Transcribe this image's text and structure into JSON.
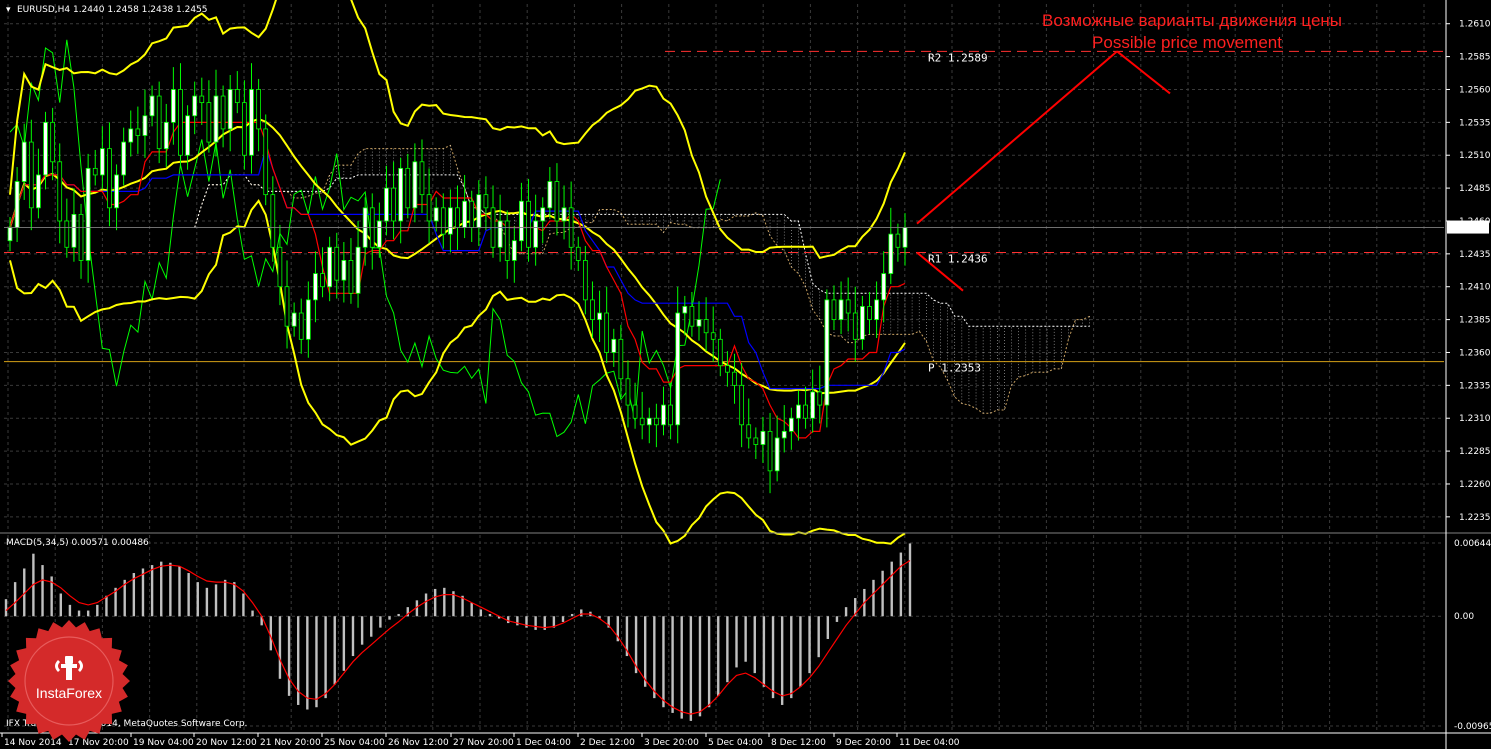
{
  "header": {
    "symbol_title": "EURUSD,H4  1.2440 1.2458 1.2438 1.2455",
    "macd_title": "MACD(5,34,5) 0.00571 0.00486"
  },
  "annotation": {
    "line1": "Возможные варианты движения цены",
    "line2": "Possible price movement"
  },
  "levels": [
    {
      "name": "R2",
      "label": "R2  1.2589",
      "value": 1.2589,
      "color": "#ff3030",
      "style": "dashed"
    },
    {
      "name": "R1",
      "label": "R1  1.2436",
      "value": 1.2436,
      "color": "#ff3030",
      "style": "dashed"
    },
    {
      "name": "P",
      "label": "P  1.2353",
      "value": 1.2353,
      "color": "#d4a017",
      "style": "solid"
    }
  ],
  "current_price": {
    "label": "1.2455",
    "value": 1.2455
  },
  "footer": {
    "copyright": "IFX Trader, © 2001-2014, MetaQuotes Software Corp."
  },
  "logo": {
    "text": "InstaForex",
    "color": "#d42a2a"
  },
  "colors": {
    "background": "#000000",
    "grid": "#3a3a3a",
    "bullish_candle": "#ffffff",
    "bearish_candle": "#000000",
    "candle_wick": "#00ff00",
    "bollinger": "#ffff00",
    "tenkan": "#ff0000",
    "kijun": "#0000ff",
    "chikou": "#00ff00",
    "cloud": "#ffffff",
    "macd_hist": "#c0c0c0",
    "macd_signal": "#ff0000",
    "forecast": "#ff0000",
    "annotation_text": "#ff2020"
  },
  "chart_data": [
    {
      "type": "candlestick",
      "title": "EURUSD,H4",
      "ylim": [
        1.2225,
        1.2625
      ],
      "y_ticks": [
        "1.2610",
        "1.2585",
        "1.2560",
        "1.2535",
        "1.2510",
        "1.2485",
        "1.2460",
        "1.2435",
        "1.2410",
        "1.2385",
        "1.2360",
        "1.2335",
        "1.2310",
        "1.2285",
        "1.2260",
        "1.2235"
      ],
      "x_labels": [
        "14 Nov 2014",
        "17 Nov 20:00",
        "19 Nov 04:00",
        "20 Nov 12:00",
        "21 Nov 20:00",
        "25 Nov 04:00",
        "26 Nov 12:00",
        "27 Nov 20:00",
        "1 Dec 04:00",
        "2 Dec 12:00",
        "3 Dec 20:00",
        "5 Dec 04:00",
        "8 Dec 12:00",
        "9 Dec 20:00",
        "11 Dec 04:00"
      ],
      "closes": [
        1.2455,
        1.249,
        1.252,
        1.247,
        1.2495,
        1.2535,
        1.2505,
        1.246,
        1.244,
        1.2465,
        1.243,
        1.25,
        1.2495,
        1.2515,
        1.247,
        1.2495,
        1.252,
        1.253,
        1.2525,
        1.254,
        1.2555,
        1.2515,
        1.2535,
        1.256,
        1.251,
        1.254,
        1.2555,
        1.255,
        1.252,
        1.2555,
        1.253,
        1.256,
        1.255,
        1.251,
        1.256,
        1.253,
        1.248,
        1.244,
        1.241,
        1.238,
        1.239,
        1.237,
        1.24,
        1.242,
        1.241,
        1.244,
        1.2415,
        1.243,
        1.2405,
        1.244,
        1.247,
        1.244,
        1.246,
        1.2485,
        1.246,
        1.25,
        1.247,
        1.2505,
        1.248,
        1.246,
        1.247,
        1.245,
        1.247,
        1.2455,
        1.2475,
        1.2455,
        1.248,
        1.247,
        1.244,
        1.246,
        1.243,
        1.2445,
        1.2475,
        1.244,
        1.246,
        1.247,
        1.249,
        1.246,
        1.247,
        1.244,
        1.243,
        1.24,
        1.2385,
        1.239,
        1.236,
        1.237,
        1.234,
        1.232,
        1.231,
        1.2305,
        1.231,
        1.2305,
        1.232,
        1.2305,
        1.239,
        1.2395,
        1.238,
        1.2385,
        1.2375,
        1.237,
        1.235,
        1.2345,
        1.2335,
        1.2305,
        1.2295,
        1.229,
        1.23,
        1.227,
        1.2295,
        1.23,
        1.231,
        1.232,
        1.231,
        1.233,
        1.232,
        1.24,
        1.2385,
        1.24,
        1.239,
        1.237,
        1.2395,
        1.2385,
        1.24,
        1.242,
        1.245,
        1.244,
        1.2455
      ],
      "x_marker_labels": [],
      "series_names": [],
      "forecast_paths": [
        {
          "from_price": 1.2458,
          "to_price": 1.2589
        },
        {
          "from_price": 1.2589,
          "to_price": 1.2557
        },
        {
          "from_price": 1.2436,
          "to_price": 1.2407
        }
      ]
    },
    {
      "type": "bar",
      "title": "MACD(5,34,5)",
      "ylim": [
        -0.00965,
        0.00644
      ],
      "y_ticks": [
        "0.00644",
        "0.00",
        "-0.00965"
      ],
      "main_value": 0.00571,
      "signal_value": 0.00486,
      "values": [
        0.0015,
        0.003,
        0.0042,
        0.0055,
        0.0045,
        0.0035,
        0.002,
        0.001,
        0.0005,
        0.0005,
        0.001,
        0.0018,
        0.0025,
        0.0032,
        0.0038,
        0.0042,
        0.0045,
        0.0048,
        0.0047,
        0.0044,
        0.0038,
        0.003,
        0.0025,
        0.0028,
        0.0032,
        0.003,
        0.002,
        0.0005,
        -0.0008,
        -0.003,
        -0.0055,
        -0.007,
        -0.0078,
        -0.0082,
        -0.008,
        -0.0072,
        -0.006,
        -0.0048,
        -0.0035,
        -0.0025,
        -0.0018,
        -0.001,
        -0.0003,
        0.0002,
        0.0008,
        0.0014,
        0.002,
        0.0024,
        0.0025,
        0.0022,
        0.0018,
        0.0012,
        0.0006,
        0.0002,
        -0.0002,
        -0.0006,
        -0.0008,
        -0.001,
        -0.0012,
        -0.0012,
        -0.001,
        -0.0005,
        0.0002,
        0.0006,
        0.0004,
        -0.0002,
        -0.001,
        -0.0022,
        -0.0035,
        -0.005,
        -0.0062,
        -0.0072,
        -0.008,
        -0.0085,
        -0.009,
        -0.0092,
        -0.0088,
        -0.008,
        -0.007,
        -0.0058,
        -0.0045,
        -0.004,
        -0.005,
        -0.0062,
        -0.0072,
        -0.0078,
        -0.0072,
        -0.0062,
        -0.005,
        -0.0036,
        -0.002,
        -0.0005,
        0.0008,
        0.0016,
        0.0024,
        0.0032,
        0.004,
        0.0048,
        0.0056,
        0.0064
      ],
      "signal": [
        0.0005,
        0.0012,
        0.002,
        0.0028,
        0.0032,
        0.003,
        0.0025,
        0.0018,
        0.0012,
        0.001,
        0.0012,
        0.0017,
        0.0022,
        0.0028,
        0.0033,
        0.0037,
        0.0041,
        0.0044,
        0.0045,
        0.0044,
        0.004,
        0.0035,
        0.0031,
        0.003,
        0.003,
        0.0028,
        0.0022,
        0.0012,
        0.0,
        -0.0018,
        -0.0038,
        -0.0055,
        -0.0066,
        -0.0072,
        -0.0073,
        -0.0068,
        -0.006,
        -0.005,
        -0.004,
        -0.0032,
        -0.0025,
        -0.0018,
        -0.0011,
        -0.0005,
        0.0002,
        0.0008,
        0.0013,
        0.0017,
        0.0019,
        0.0019,
        0.0016,
        0.0012,
        0.0008,
        0.0004,
        0.0,
        -0.0004,
        -0.0006,
        -0.0008,
        -0.0009,
        -0.001,
        -0.0009,
        -0.0006,
        -0.0002,
        0.0002,
        0.0002,
        -0.0002,
        -0.0008,
        -0.0018,
        -0.003,
        -0.0044,
        -0.0056,
        -0.0066,
        -0.0074,
        -0.008,
        -0.0084,
        -0.0086,
        -0.0084,
        -0.0078,
        -0.007,
        -0.006,
        -0.0052,
        -0.005,
        -0.0054,
        -0.006,
        -0.0066,
        -0.007,
        -0.0068,
        -0.0062,
        -0.0054,
        -0.0044,
        -0.0032,
        -0.002,
        -0.0008,
        0.0002,
        0.0012,
        0.002,
        0.0028,
        0.0036,
        0.0044,
        0.0049
      ]
    }
  ]
}
